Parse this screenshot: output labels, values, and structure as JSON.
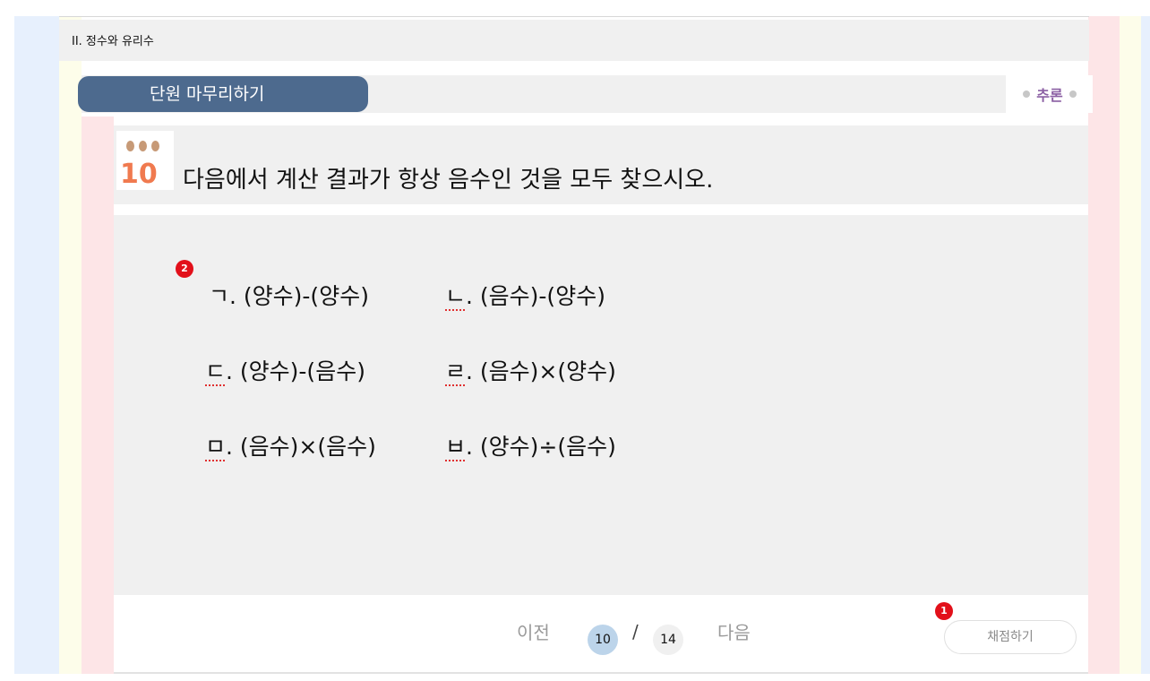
{
  "unit": {
    "title": "II. 정수와 유리수"
  },
  "section": {
    "title": "단원 마무리하기",
    "skill": "추론"
  },
  "question": {
    "number": "10",
    "text": "다음에서 계산 결과가 항상 음수인 것을 모두 찾으시오."
  },
  "choices": [
    {
      "label": "ㄱ",
      "expr": ". (양수)-(양수)",
      "marked": false
    },
    {
      "label": "ㄴ",
      "expr": ". (음수)-(양수)",
      "marked": true
    },
    {
      "label": "ㄷ",
      "expr": ". (양수)-(음수)",
      "marked": true
    },
    {
      "label": "ㄹ",
      "expr": ". (음수)×(양수)",
      "marked": true
    },
    {
      "label": "ㅁ",
      "expr": ". (음수)×(음수)",
      "marked": true
    },
    {
      "label": "ㅂ",
      "expr": ". (양수)÷(음수)",
      "marked": true
    }
  ],
  "badges": {
    "grade": "1",
    "choices": "2"
  },
  "pager": {
    "prev": "이전",
    "current": "10",
    "separator": "/",
    "total": "14",
    "next": "다음"
  },
  "grade_button": "채점하기",
  "colors": {
    "pill": "#4d6a8e",
    "number": "#f07a4f",
    "skill": "#8b5fa3",
    "badge": "#e2101a",
    "current_page": "#bcd4ea"
  }
}
